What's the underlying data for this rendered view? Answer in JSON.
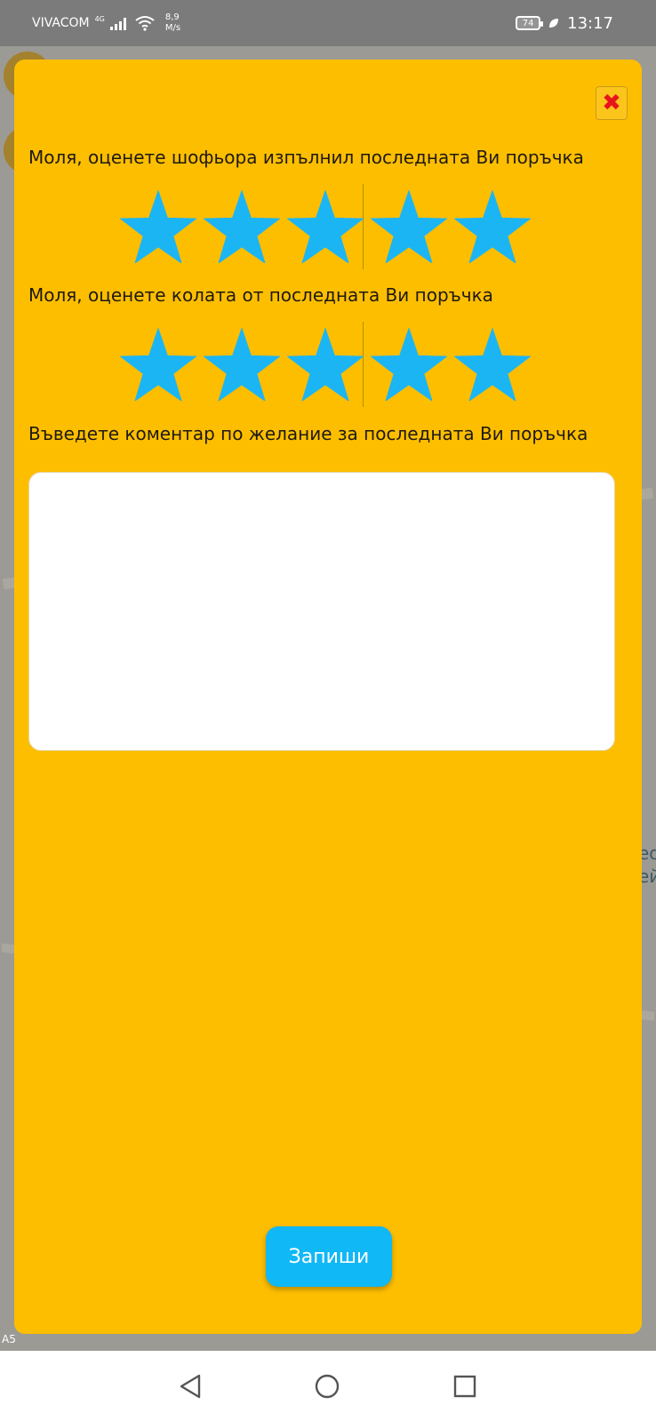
{
  "status_bar": {
    "carrier": "VIVACOM",
    "network": "4G",
    "speed_value": "8,9",
    "speed_unit": "M/s",
    "battery": "74",
    "time": "13:17"
  },
  "rating_dialog": {
    "driver_prompt": "Моля, оценете шофьора изпълнил последната Ви поръчка",
    "driver_rating": 5,
    "driver_rating_max": 5,
    "car_prompt": "Моля, оценете колата от последната Ви поръчка",
    "car_rating": 5,
    "car_rating_max": 5,
    "comment_prompt": "Въведете коментар по желание за последната Ви поръчка",
    "comment_value": "",
    "close_icon": "close-x-icon",
    "save_label": "Запиши"
  },
  "background_map": {
    "visible_text": [
      "ео",
      "ей"
    ],
    "road_label": "A5"
  },
  "colors": {
    "modal_bg": "#fdbe00",
    "star": "#1cb5f4",
    "save_button": "#10b8f6",
    "close_x": "#e8141c"
  },
  "nav_bar": {
    "back_icon": "back-triangle-icon",
    "home_icon": "home-circle-icon",
    "recents_icon": "recents-square-icon"
  }
}
